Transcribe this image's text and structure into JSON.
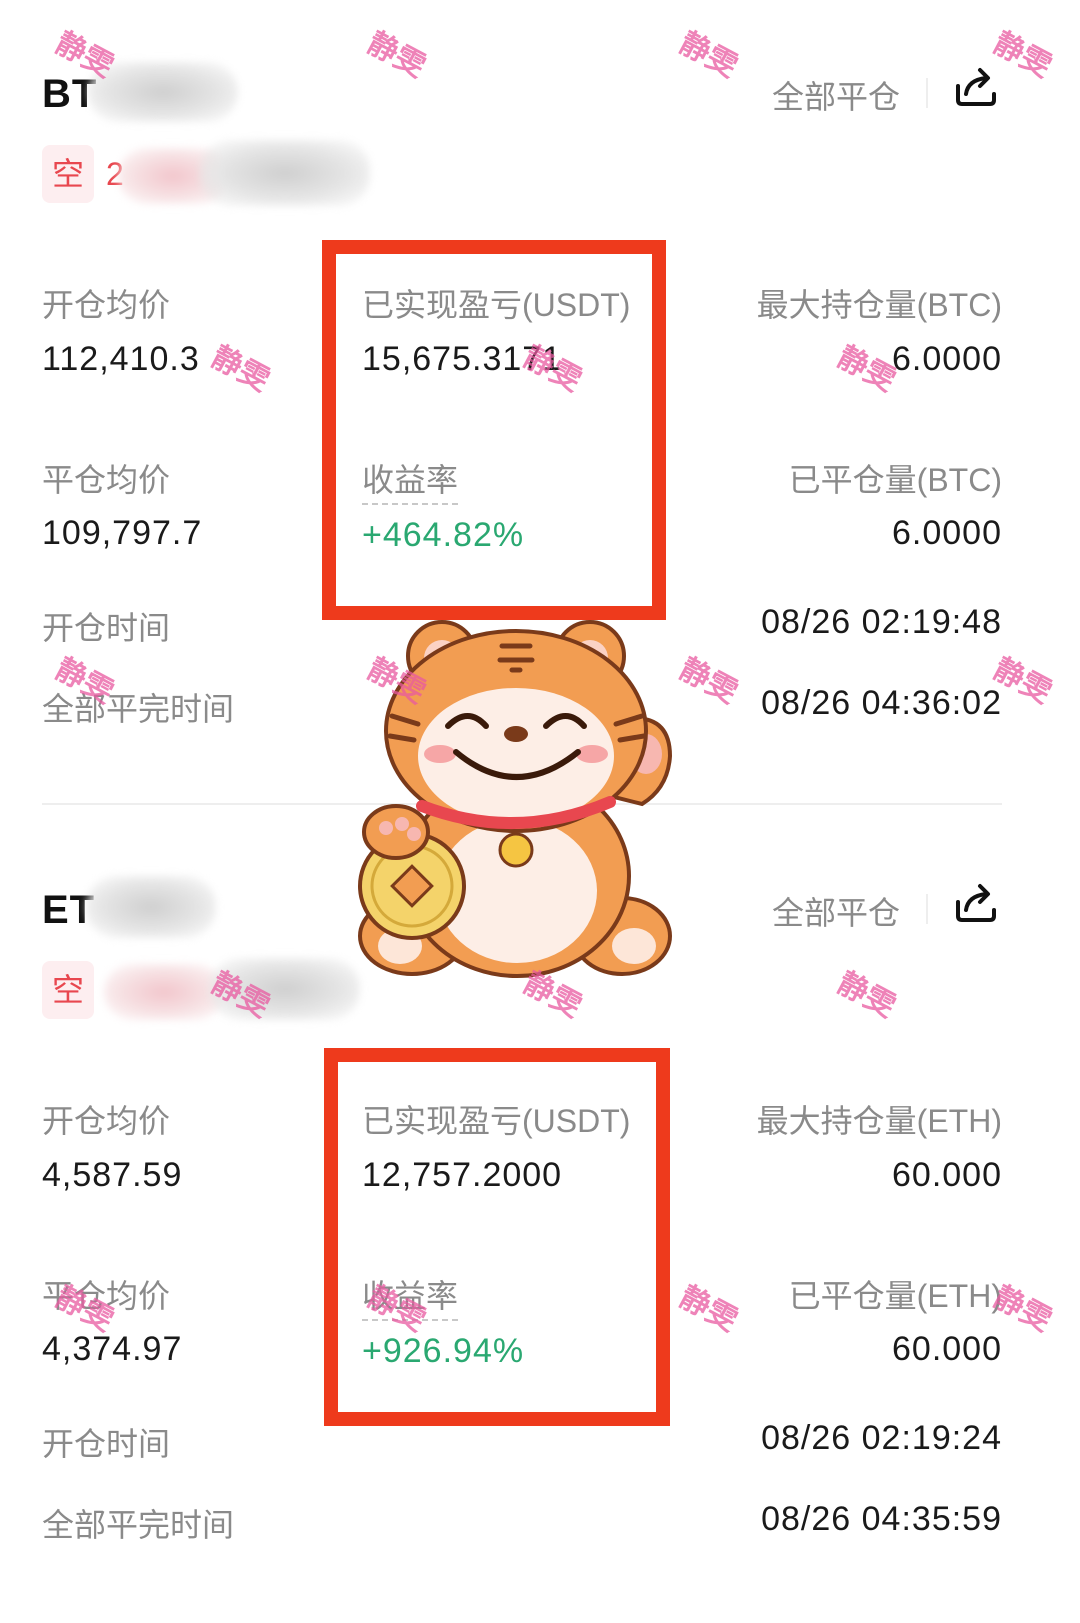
{
  "btc": {
    "symbol_visible": "BT",
    "side": "空",
    "side_number_visible": "2",
    "close_all_label": "全部平仓",
    "open_avg_label": "开仓均价",
    "open_avg_value": "112,410.3",
    "realized_pnl_label": "已实现盈亏(USDT)",
    "realized_pnl_value": "15,675.3171",
    "max_position_label": "最大持仓量(BTC)",
    "max_position_value": "6.0000",
    "close_avg_label": "平仓均价",
    "close_avg_value": "109,797.7",
    "roi_label": "收益率",
    "roi_value": "+464.82%",
    "closed_position_label": "已平仓量(BTC)",
    "closed_position_value": "6.0000",
    "open_time_label": "开仓时间",
    "open_time_value": "08/26 02:19:48",
    "full_close_time_label": "全部平完时间",
    "full_close_time_value": "08/26 04:36:02"
  },
  "eth": {
    "symbol_visible": "ET",
    "side": "空",
    "close_all_label": "全部平仓",
    "open_avg_label": "开仓均价",
    "open_avg_value": "4,587.59",
    "realized_pnl_label": "已实现盈亏(USDT)",
    "realized_pnl_value": "12,757.2000",
    "max_position_label": "最大持仓量(ETH)",
    "max_position_value": "60.000",
    "close_avg_label": "平仓均价",
    "close_avg_value": "4,374.97",
    "roi_label": "收益率",
    "roi_value": "+926.94%",
    "closed_position_label": "已平仓量(ETH)",
    "closed_position_value": "60.000",
    "open_time_label": "开仓时间",
    "open_time_value": "08/26 02:19:24",
    "full_close_time_label": "全部平完时间",
    "full_close_time_value": "08/26 04:35:59"
  },
  "watermark_text": "静雯",
  "icons": {
    "share": "share-icon",
    "mascot": "tiger-mascot-sticker"
  },
  "colors": {
    "profit_green": "#2aa871",
    "short_red": "#e8474f",
    "highlight_red": "#ee3a1c"
  }
}
